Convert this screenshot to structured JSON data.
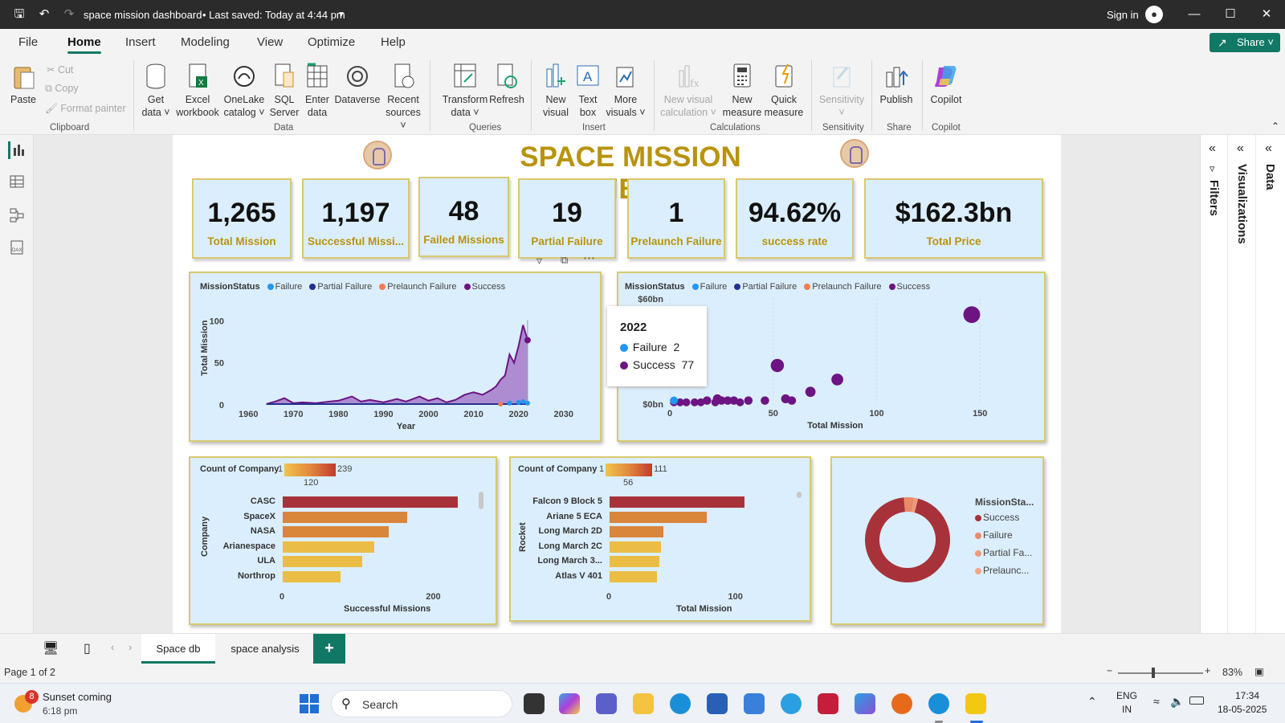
{
  "titlebar": {
    "title": "space mission dashboard",
    "saved": "• Last saved: Today at 4:44 pm",
    "sign_in": "Sign in"
  },
  "menu": [
    "File",
    "Home",
    "Insert",
    "Modeling",
    "View",
    "Optimize",
    "Help"
  ],
  "share": "Share",
  "ribbon": {
    "clipboard": {
      "paste": "Paste",
      "cut": "Cut",
      "copy": "Copy",
      "format_painter": "Format painter",
      "group": "Clipboard"
    },
    "data": {
      "get_data": "Get data",
      "excel": "Excel workbook",
      "onelake": "OneLake catalog",
      "sql": "SQL Server",
      "enter": "Enter data",
      "dataverse": "Dataverse",
      "recent": "Recent sources",
      "group": "Data"
    },
    "queries": {
      "transform": "Transform data",
      "refresh": "Refresh",
      "group": "Queries"
    },
    "insert": {
      "new_visual": "New visual",
      "text_box": "Text box",
      "more_visuals": "More visuals",
      "group": "Insert"
    },
    "calculations": {
      "new_visual_calc": "New visual calculation",
      "new_measure": "New measure",
      "quick_measure": "Quick measure",
      "group": "Calculations"
    },
    "sensitivity": {
      "label": "Sensitivity",
      "group": "Sensitivity"
    },
    "share": {
      "publish": "Publish",
      "group": "Share"
    },
    "copilot": {
      "label": "Copilot",
      "group": "Copilot"
    }
  },
  "panes": {
    "filters": "Filters",
    "visualizations": "Visualizations",
    "data": "Data"
  },
  "dashboard": {
    "title": "SPACE MISSION DASHBOARD",
    "kpis": [
      {
        "value": "1,265",
        "label": "Total Mission"
      },
      {
        "value": "1,197",
        "label": "Successful Missi..."
      },
      {
        "value": "48",
        "label": "Failed Missions"
      },
      {
        "value": "19",
        "label": "Partial Failure"
      },
      {
        "value": "1",
        "label": "Prelaunch Failure"
      },
      {
        "value": "94.62%",
        "label": "success rate"
      },
      {
        "value": "$162.3bn",
        "label": "Total Price"
      }
    ],
    "legend": {
      "title": "MissionStatus",
      "items": [
        "Failure",
        "Partial Failure",
        "Prelaunch Failure",
        "Success"
      ]
    },
    "colors": {
      "failure": "#2196f3",
      "partial": "#22318f",
      "prelaunch": "#ef7d4f",
      "success": "#6c1482",
      "area": "#a57ac9",
      "gold": "#b8940d",
      "bar_dark": "#a8323a",
      "bar_mid": "#d9853a",
      "bar_light": "#ebbd45"
    }
  },
  "chart_data": [
    {
      "type": "area",
      "xlabel": "Year",
      "ylabel": "Total Mission",
      "x_ticks": [
        "1960",
        "1970",
        "1980",
        "1990",
        "2000",
        "2010",
        "2020",
        "2030"
      ],
      "y_ticks": [
        "0",
        "50",
        "100"
      ],
      "ylim": [
        0,
        130
      ],
      "xlim": [
        1958,
        2032
      ],
      "series": [
        {
          "name": "Success",
          "x": [
            1964,
            1966,
            1968,
            1970,
            1972,
            1975,
            1978,
            1980,
            1983,
            1985,
            1987,
            1990,
            1993,
            1995,
            1998,
            2000,
            2002,
            2004,
            2006,
            2008,
            2010,
            2012,
            2014,
            2015,
            2016,
            2017,
            2018,
            2019,
            2020,
            2021,
            2022
          ],
          "values": [
            1,
            4,
            8,
            2,
            3,
            2,
            4,
            5,
            10,
            4,
            6,
            3,
            7,
            4,
            10,
            5,
            8,
            3,
            6,
            12,
            15,
            12,
            18,
            22,
            30,
            35,
            60,
            50,
            70,
            95,
            77
          ]
        },
        {
          "name": "Failure",
          "x": [
            2018,
            2020,
            2021,
            2022
          ],
          "values": [
            2,
            3,
            4,
            2
          ]
        },
        {
          "name": "Prelaunch Failure",
          "x": [
            2016
          ],
          "values": [
            1
          ]
        }
      ]
    },
    {
      "type": "scatter",
      "xlabel": "Total Mission",
      "x_ticks": [
        "0",
        "50",
        "100",
        "150"
      ],
      "y_ticks": [
        "$0bn",
        "$60bn"
      ],
      "xlim": [
        0,
        160
      ],
      "ylim": [
        0,
        60
      ],
      "series": [
        {
          "name": "Success",
          "points": [
            [
              2,
              1
            ],
            [
              5,
              1
            ],
            [
              8,
              1
            ],
            [
              12,
              1
            ],
            [
              15,
              1
            ],
            [
              18,
              2
            ],
            [
              22,
              1
            ],
            [
              23,
              3
            ],
            [
              25,
              2
            ],
            [
              28,
              2
            ],
            [
              31,
              2
            ],
            [
              34,
              1
            ],
            [
              38,
              2
            ],
            [
              46,
              2
            ],
            [
              52,
              22
            ],
            [
              56,
              3
            ],
            [
              59,
              2
            ],
            [
              68,
              7
            ],
            [
              81,
              14
            ],
            [
              146,
              51
            ]
          ]
        },
        {
          "name": "Failure",
          "points": [
            [
              2,
              2
            ]
          ]
        }
      ],
      "tooltip": {
        "year": "2022",
        "rows": [
          {
            "name": "Failure",
            "value": "2"
          },
          {
            "name": "Success",
            "value": "77"
          }
        ]
      }
    },
    {
      "type": "bar",
      "orientation": "horizontal",
      "title": "Count of Company",
      "ylabel": "Company",
      "xlabel": "Successful Missions",
      "scale": {
        "min": "1",
        "mid": "120",
        "max": "239"
      },
      "x_ticks": [
        "0",
        "200"
      ],
      "xlim": [
        0,
        260
      ],
      "categories": [
        "CASC",
        "SpaceX",
        "NASA",
        "Arianespace",
        "ULA",
        "Northrop"
      ],
      "values": [
        239,
        170,
        145,
        125,
        109,
        79
      ]
    },
    {
      "type": "bar",
      "orientation": "horizontal",
      "title": "Count of Company",
      "ylabel": "Rocket",
      "xlabel": "Total Mission",
      "scale": {
        "min": "1",
        "mid": "56",
        "max": "111"
      },
      "x_ticks": [
        "0",
        "100"
      ],
      "xlim": [
        0,
        130
      ],
      "categories": [
        "Falcon 9 Block 5",
        "Ariane 5 ECA",
        "Long March 2D",
        "Long March 2C",
        "Long March 3...",
        "Atlas V 401"
      ],
      "values": [
        111,
        80,
        44,
        42,
        41,
        39
      ]
    },
    {
      "type": "pie",
      "variant": "donut",
      "legend_title": "MissionSta...",
      "categories": [
        "Success",
        "Failure",
        "Partial Fa...",
        "Prelaunc..."
      ],
      "values": [
        1197,
        48,
        19,
        1
      ]
    }
  ],
  "tabs": {
    "active": "Space db",
    "other": "space analysis",
    "add": "+"
  },
  "status": {
    "page": "Page 1 of 2",
    "zoom": "83%"
  },
  "taskbar": {
    "weather_count": "8",
    "weather_title": "Sunset coming",
    "weather_time": "6:18 pm",
    "search": "Search",
    "lang1": "ENG",
    "lang2": "IN",
    "time": "17:34",
    "date": "18-05-2025"
  }
}
